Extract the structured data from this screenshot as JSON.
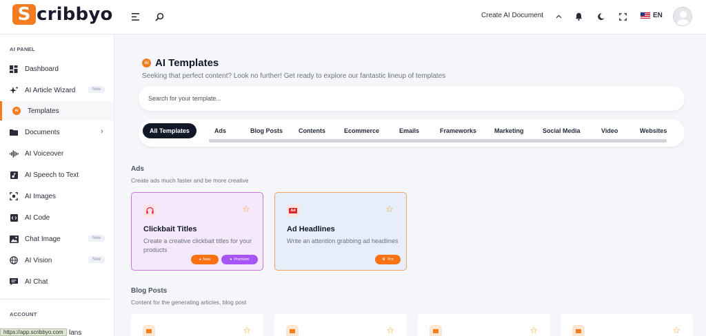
{
  "brand": {
    "logo_letter": "S",
    "logo_rest": "cribbyo",
    "accent": "#f47c20"
  },
  "header": {
    "create_doc": "Create AI Document",
    "language": "EN"
  },
  "sidebar": {
    "ai_panel_label": "AI PANEL",
    "account_label": "ACCOUNT",
    "items": [
      {
        "label": "Dashboard",
        "icon": "dashboard-icon"
      },
      {
        "label": "AI Article Wizard",
        "icon": "sparkle-icon",
        "badge": "New"
      },
      {
        "label": "Templates",
        "icon": "ai-icon",
        "active": true
      },
      {
        "label": "Documents",
        "icon": "folder-icon",
        "chevron": true
      },
      {
        "label": "AI Voiceover",
        "icon": "waveform-icon"
      },
      {
        "label": "AI Speech to Text",
        "icon": "music-note-icon"
      },
      {
        "label": "AI Images",
        "icon": "image-scan-icon"
      },
      {
        "label": "AI Code",
        "icon": "code-icon"
      },
      {
        "label": "Chat Image",
        "icon": "photo-icon",
        "badge": "New"
      },
      {
        "label": "AI Vision",
        "icon": "globe-icon",
        "badge": "New"
      },
      {
        "label": "AI Chat",
        "icon": "chat-icon"
      }
    ],
    "partial_item": "lans"
  },
  "status_url": "https://app.scribbyo.com",
  "main": {
    "title_icon": "AI",
    "title": "AI Templates",
    "subtitle": "Seeking that perfect content? Look no further! Get ready to explore our fantastic lineup of templates",
    "search_placeholder": "Search for your template...",
    "tabs": [
      "All Templates",
      "Ads",
      "Blog Posts",
      "Contents",
      "Ecommerce",
      "Emails",
      "Frameworks",
      "Marketing",
      "Social Media",
      "Video",
      "Websites"
    ],
    "sections": [
      {
        "title": "Ads",
        "description": "Create ads much faster and be more creative",
        "cards": [
          {
            "title": "Clickbait Titles",
            "description": "Create a creative clickbait titles for your products",
            "icon": "headphones-icon",
            "badges": [
              "New",
              "Premium"
            ],
            "style": "pink"
          },
          {
            "title": "Ad Headlines",
            "description": "Write an attention grabbing ad headlines",
            "icon": "ad-icon",
            "icon_text": "Ad",
            "badges": [
              "Pro"
            ],
            "style": "blue"
          }
        ]
      },
      {
        "title": "Blog Posts",
        "description": "Content for the generating articles, blog post"
      }
    ]
  }
}
